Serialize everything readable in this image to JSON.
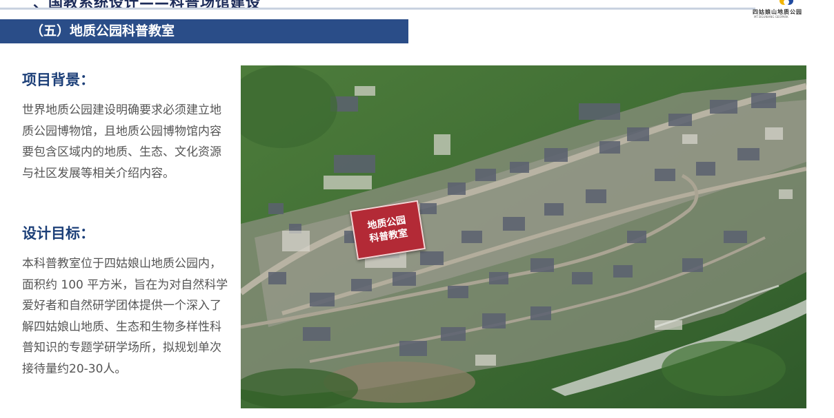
{
  "header": {
    "title": "、国教系统设计——科普场馆建设",
    "logo_text": "四姑娘山地质公园",
    "logo_subtext": "MT.SIGUNIANG GEOPARK"
  },
  "section": {
    "title": "（五）地质公园科普教室"
  },
  "background": {
    "heading": "项目背景：",
    "text": "世界地质公园建设明确要求必须建立地质公园博物馆，且地质公园博物馆内容要包含区域内的地质、生态、文化资源与社区发展等相关介绍内容。"
  },
  "goal": {
    "heading": "设计目标：",
    "text": "本科普教室位于四姑娘山地质公园内，面积约 100 平方米，旨在为对自然科学爱好者和自然研学团体提供一个深入了解四姑娘山地质、生态和生物多样性科普知识的专题学研学场所，拟规划单次接待量约20-30人。"
  },
  "map_label": {
    "line1": "地质公园",
    "line2": "科普教室"
  }
}
